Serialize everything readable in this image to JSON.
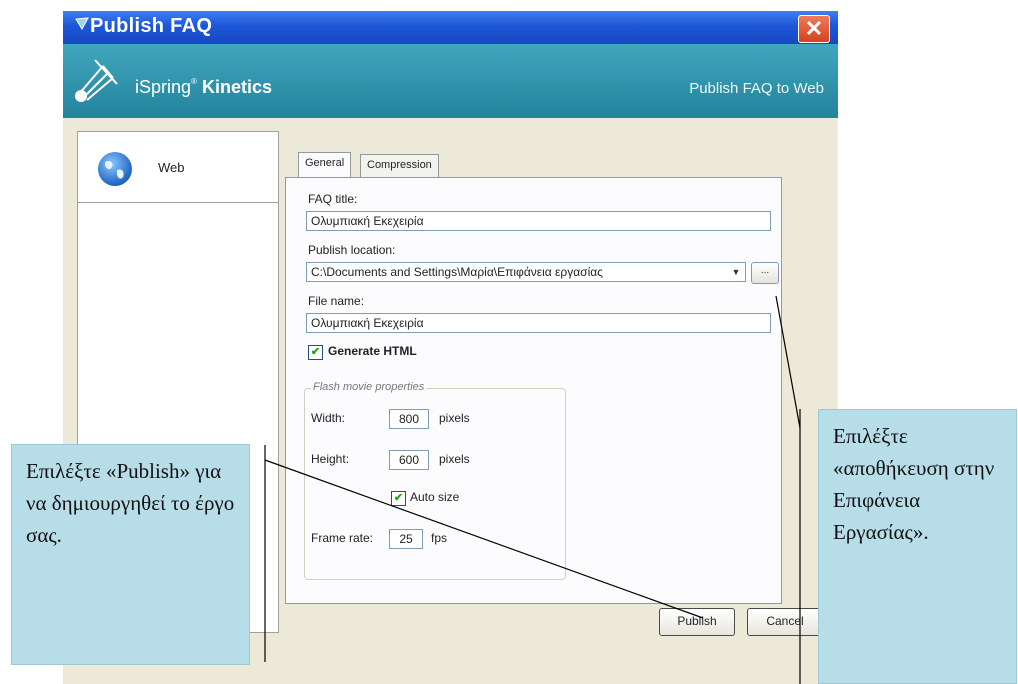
{
  "window": {
    "title": "Publish FAQ",
    "close_label": "✕"
  },
  "banner": {
    "brand_prefix": "iSpring",
    "brand_sup": "®",
    "brand_suffix": "Kinetics",
    "subtitle": "Publish FAQ to Web"
  },
  "nav": {
    "items": [
      {
        "label": "Web",
        "icon": "globe-icon"
      }
    ]
  },
  "tabs": [
    {
      "label": "General",
      "active": true
    },
    {
      "label": "Compression",
      "active": false
    }
  ],
  "general": {
    "faq_title_label": "FAQ title:",
    "faq_title_value": "Ολυμπιακή Εκεχειρία",
    "publish_location_label": "Publish location:",
    "publish_location_value": "C:\\Documents and Settings\\Μαρία\\Επιφάνεια εργασίας",
    "browse_label": "...",
    "file_name_label": "File name:",
    "file_name_value": "Ολυμπιακή Εκεχειρία",
    "generate_html_label": "Generate HTML",
    "generate_html_checked": true
  },
  "flash": {
    "group_label": "Flash movie properties",
    "width_label": "Width:",
    "width_value": "800",
    "width_unit": "pixels",
    "height_label": "Height:",
    "height_value": "600",
    "height_unit": "pixels",
    "auto_size_label": "Auto size",
    "auto_size_checked": true,
    "frame_rate_label": "Frame rate:",
    "frame_rate_value": "25",
    "frame_rate_unit": "fps"
  },
  "buttons": {
    "publish": "Publish",
    "cancel": "Cancel"
  },
  "callouts": {
    "left": "Επιλέξτε «Publish» για να δημιουργηθεί το έργο σας.",
    "right": "Επιλέξτε «αποθήκευση στην Επιφάνεια Εργασίας»."
  },
  "colors": {
    "titlebar": "#1d57d8",
    "banner": "#2a8fa6",
    "dialog_body": "#ece9d8",
    "callout": "#b7dde8"
  }
}
